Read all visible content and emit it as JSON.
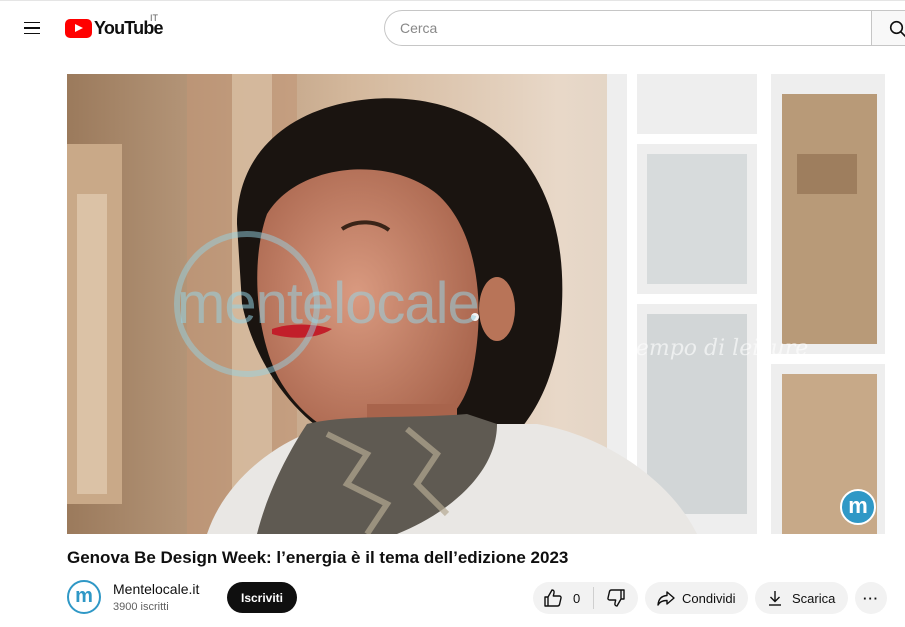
{
  "header": {
    "logo_text": "YouTube",
    "country_code": "IT",
    "search_placeholder": "Cerca",
    "icons": [
      "menu-icon",
      "youtube-logo-icon",
      "search-icon"
    ]
  },
  "video": {
    "watermark_text": "mentelocale",
    "watermark_tagline": "tempo di leisure",
    "corner_logo_letter": "m",
    "title": "Genova Be Design Week: l’energia è il tema dell’edizione 2023"
  },
  "channel": {
    "avatar_letter": "m",
    "name": "Mentelocale.it",
    "subscribers": "3900 iscritti",
    "subscribe_label": "Iscriviti"
  },
  "actions": {
    "like_count": "0",
    "share_label": "Condividi",
    "download_label": "Scarica",
    "more_label": "···",
    "icons": [
      "thumbs-up-icon",
      "thumbs-down-icon",
      "share-icon",
      "download-icon",
      "more-icon"
    ]
  },
  "colors": {
    "brand_red": "#ff0000",
    "subscribe_bg": "#0f0f0f",
    "channel_accent": "#2f98c6"
  }
}
